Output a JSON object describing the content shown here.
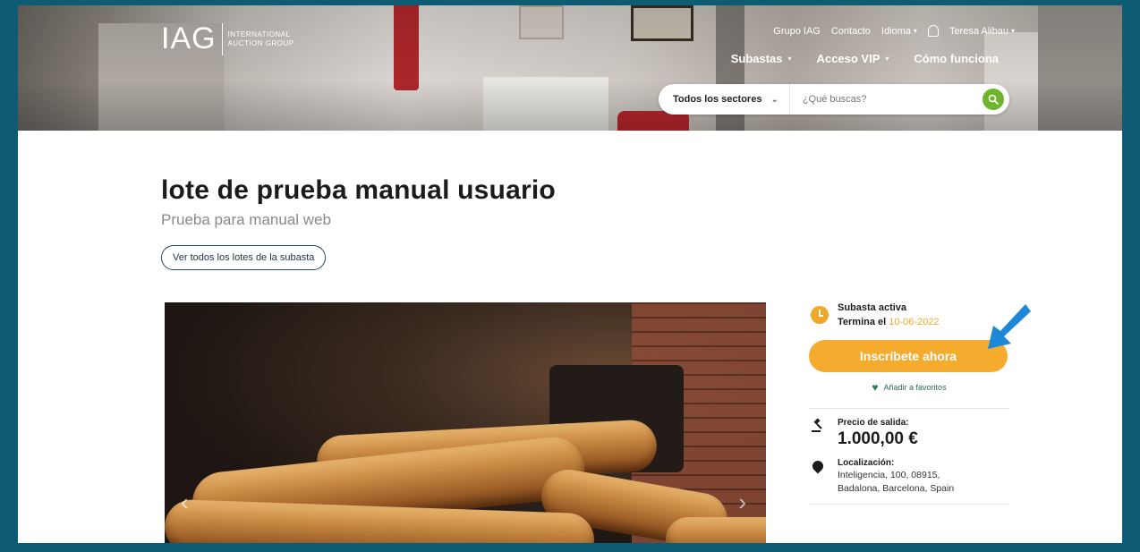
{
  "header": {
    "logo_mark": "IAG",
    "logo_line1": "International",
    "logo_line2": "Auction Group",
    "topnav": {
      "grupo": "Grupo IAG",
      "contacto": "Contacto",
      "idioma": "Idioma",
      "user": "Teresa Alibau"
    },
    "mainnav": {
      "subastas": "Subastas",
      "acceso_vip": "Acceso VIP",
      "como_funciona": "Cómo funciona"
    },
    "search": {
      "sector": "Todos los sectores",
      "placeholder": "¿Qué buscas?"
    }
  },
  "lot": {
    "title": "lote de prueba manual usuario",
    "subtitle": "Prueba para manual web",
    "all_lots_button": "Ver todos los lotes de la subasta"
  },
  "sidebar": {
    "status": "Subasta activa",
    "ends_prefix": "Termina el",
    "ends_date": "10-06-2022",
    "cta": "Inscríbete ahora",
    "favorite": "Añadir a favoritos",
    "price_label": "Precio de salida:",
    "price_value": "1.000,00 €",
    "location_label": "Localización:",
    "location_line1": "Inteligencia, 100, 08915,",
    "location_line2": "Badalona, Barcelona, Spain"
  },
  "colors": {
    "frame": "#0e5c74",
    "accent": "#f4ab2e",
    "search_button": "#6fb52c",
    "pointer": "#1e88d8"
  },
  "icons": [
    "bell-icon",
    "search-icon",
    "clock-icon",
    "heart-icon",
    "gavel-icon",
    "location-pin-icon",
    "chevron-left-icon",
    "chevron-right-icon",
    "pointer-arrow-icon"
  ]
}
